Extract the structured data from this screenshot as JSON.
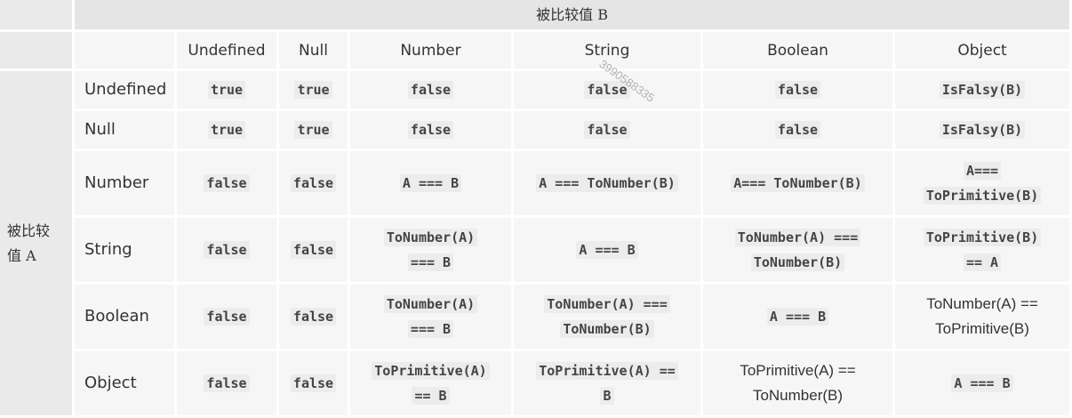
{
  "top_header": "被比较值 B",
  "side_header": "被比较值 A",
  "columns": [
    "Undefined",
    "Null",
    "Number",
    "String",
    "Boolean",
    "Object"
  ],
  "rows": [
    {
      "label": "Undefined",
      "cells": [
        {
          "lines": [
            "true"
          ],
          "mono": true
        },
        {
          "lines": [
            "true"
          ],
          "mono": true
        },
        {
          "lines": [
            "false"
          ],
          "mono": true
        },
        {
          "lines": [
            "false"
          ],
          "mono": true
        },
        {
          "lines": [
            "false"
          ],
          "mono": true
        },
        {
          "lines": [
            "IsFalsy(B)"
          ],
          "mono": true
        }
      ]
    },
    {
      "label": "Null",
      "cells": [
        {
          "lines": [
            "true"
          ],
          "mono": true
        },
        {
          "lines": [
            "true"
          ],
          "mono": true
        },
        {
          "lines": [
            "false"
          ],
          "mono": true
        },
        {
          "lines": [
            "false"
          ],
          "mono": true
        },
        {
          "lines": [
            "false"
          ],
          "mono": true
        },
        {
          "lines": [
            "IsFalsy(B)"
          ],
          "mono": true
        }
      ]
    },
    {
      "label": "Number",
      "cells": [
        {
          "lines": [
            "false"
          ],
          "mono": true
        },
        {
          "lines": [
            "false"
          ],
          "mono": true
        },
        {
          "lines": [
            "A === B"
          ],
          "mono": true
        },
        {
          "lines": [
            "A === ToNumber(B)"
          ],
          "mono": true
        },
        {
          "lines": [
            "A=== ToNumber(B)"
          ],
          "mono": true
        },
        {
          "lines": [
            "A===",
            "ToPrimitive(B)"
          ],
          "mono": true
        }
      ]
    },
    {
      "label": "String",
      "cells": [
        {
          "lines": [
            "false"
          ],
          "mono": true
        },
        {
          "lines": [
            "false"
          ],
          "mono": true
        },
        {
          "lines": [
            "ToNumber(A)",
            "=== B"
          ],
          "mono": true
        },
        {
          "lines": [
            "A === B"
          ],
          "mono": true
        },
        {
          "lines": [
            "ToNumber(A) ===",
            "ToNumber(B)"
          ],
          "mono": true
        },
        {
          "lines": [
            "ToPrimitive(B)",
            "== A"
          ],
          "mono": true
        }
      ]
    },
    {
      "label": "Boolean",
      "cells": [
        {
          "lines": [
            "false"
          ],
          "mono": true
        },
        {
          "lines": [
            "false"
          ],
          "mono": true
        },
        {
          "lines": [
            "ToNumber(A)",
            "=== B"
          ],
          "mono": true
        },
        {
          "lines": [
            "ToNumber(A) ===",
            "ToNumber(B)"
          ],
          "mono": true
        },
        {
          "lines": [
            "A === B"
          ],
          "mono": true
        },
        {
          "lines": [
            "ToNumber(A) ==",
            "ToPrimitive(B)"
          ],
          "mono": false
        }
      ]
    },
    {
      "label": "Object",
      "cells": [
        {
          "lines": [
            "false"
          ],
          "mono": true
        },
        {
          "lines": [
            "false"
          ],
          "mono": true
        },
        {
          "lines": [
            "ToPrimitive(A)",
            "== B"
          ],
          "mono": true
        },
        {
          "lines": [
            "ToPrimitive(A) ==",
            "B"
          ],
          "mono": true
        },
        {
          "lines": [
            "ToPrimitive(A) ==",
            "ToNumber(B)"
          ],
          "mono": false
        },
        {
          "lines": [
            "A === B"
          ],
          "mono": true
        }
      ]
    }
  ],
  "watermark": "3990588335"
}
